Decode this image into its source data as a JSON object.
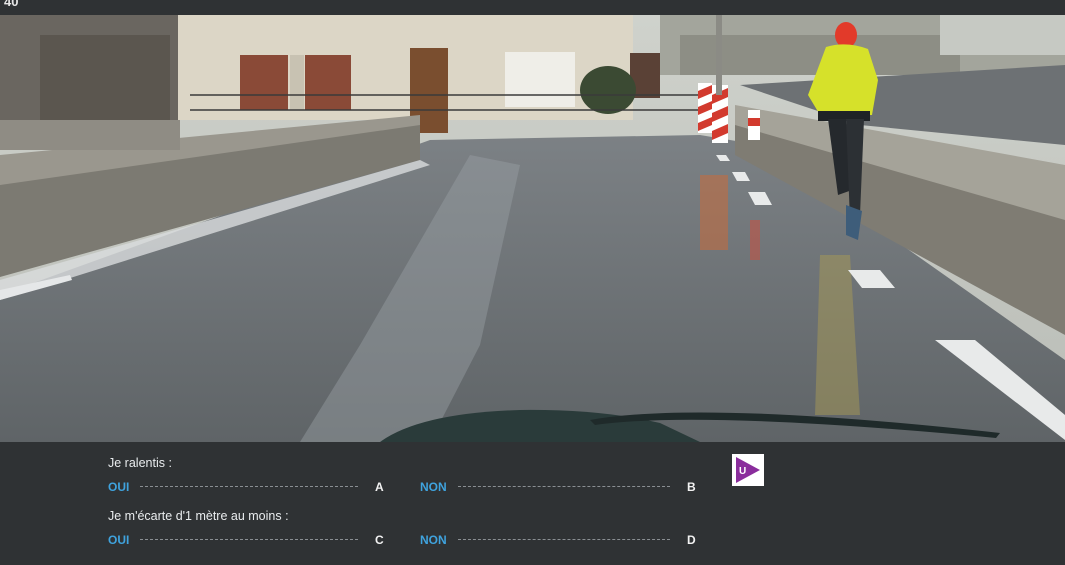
{
  "header": {
    "question_number": "40"
  },
  "scene": {
    "description_icon": "road-photo"
  },
  "questions": [
    {
      "label": "Je ralentis :",
      "options": [
        {
          "text": "OUI",
          "letter": "A"
        },
        {
          "text": "NON",
          "letter": "B"
        }
      ]
    },
    {
      "label": "Je m'écarte d'1 mètre au moins :",
      "options": [
        {
          "text": "OUI",
          "letter": "C"
        },
        {
          "text": "NON",
          "letter": "D"
        }
      ]
    }
  ],
  "logo": {
    "letter": "U",
    "icon": "play-logo-icon"
  },
  "colors": {
    "answer": "#3fa3de",
    "panel": "#2f3234",
    "logo_purple": "#8a2d9c",
    "jacket": "#d6e12a"
  }
}
